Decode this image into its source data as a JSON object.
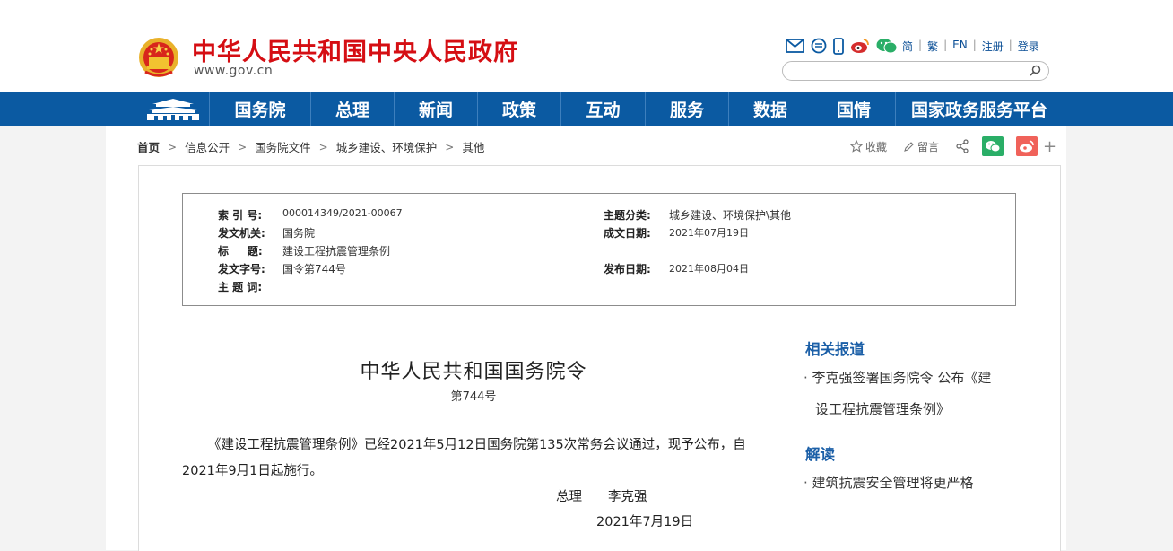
{
  "header": {
    "site_title": "中华人民共和国中央人民政府",
    "site_domain": "www.gov.cn",
    "icons": [
      "mail-icon",
      "message-icon",
      "mobile-icon",
      "weibo-icon",
      "wechat-icon"
    ],
    "links": [
      "简",
      "繁",
      "EN",
      "注册",
      "登录"
    ],
    "search_placeholder": ""
  },
  "nav": {
    "items": [
      "国务院",
      "总理",
      "新闻",
      "政策",
      "互动",
      "服务",
      "数据",
      "国情",
      "国家政务服务平台"
    ]
  },
  "breadcrumb": {
    "items": [
      "首页",
      "信息公开",
      "国务院文件",
      "城乡建设、环境保护",
      "其他"
    ]
  },
  "tools": {
    "favorite": "收藏",
    "comment": "留言"
  },
  "meta": {
    "index_label": "索 引 号:",
    "index_value": "000014349/2021-00067",
    "topic_label": "主题分类:",
    "topic_value": "城乡建设、环境保护\\其他",
    "issuer_label": "发文机关:",
    "issuer_value": "国务院",
    "created_label": "成文日期:",
    "created_value": "2021年07月19日",
    "title_label": "标     题:",
    "title_value": "建设工程抗震管理条例",
    "docno_label": "发文字号:",
    "docno_value": "国令第744号",
    "published_label": "发布日期:",
    "published_value": "2021年08月04日",
    "keywords_label": "主 题 词:",
    "keywords_value": ""
  },
  "article": {
    "title": "中华人民共和国国务院令",
    "number": "第744号",
    "body": "《建设工程抗震管理条例》已经2021年5月12日国务院第135次常务会议通过，现予公布，自2021年9月1日起施行。",
    "signature": "总理　　李克强",
    "date": "2021年7月19日"
  },
  "sidebar": {
    "related_heading": "相关报道",
    "related_line1": "李克强签署国务院令 公布《建",
    "related_line2": "设工程抗震管理条例》",
    "interpret_heading": "解读",
    "interpret_item": "建筑抗震安全管理将更严格"
  },
  "colors": {
    "brand_red": "#d50e13",
    "nav_blue": "#0b5aa2",
    "link_blue": "#1b5fa7",
    "wechat_green": "#2aae67",
    "weibo_red": "#f0625a"
  }
}
